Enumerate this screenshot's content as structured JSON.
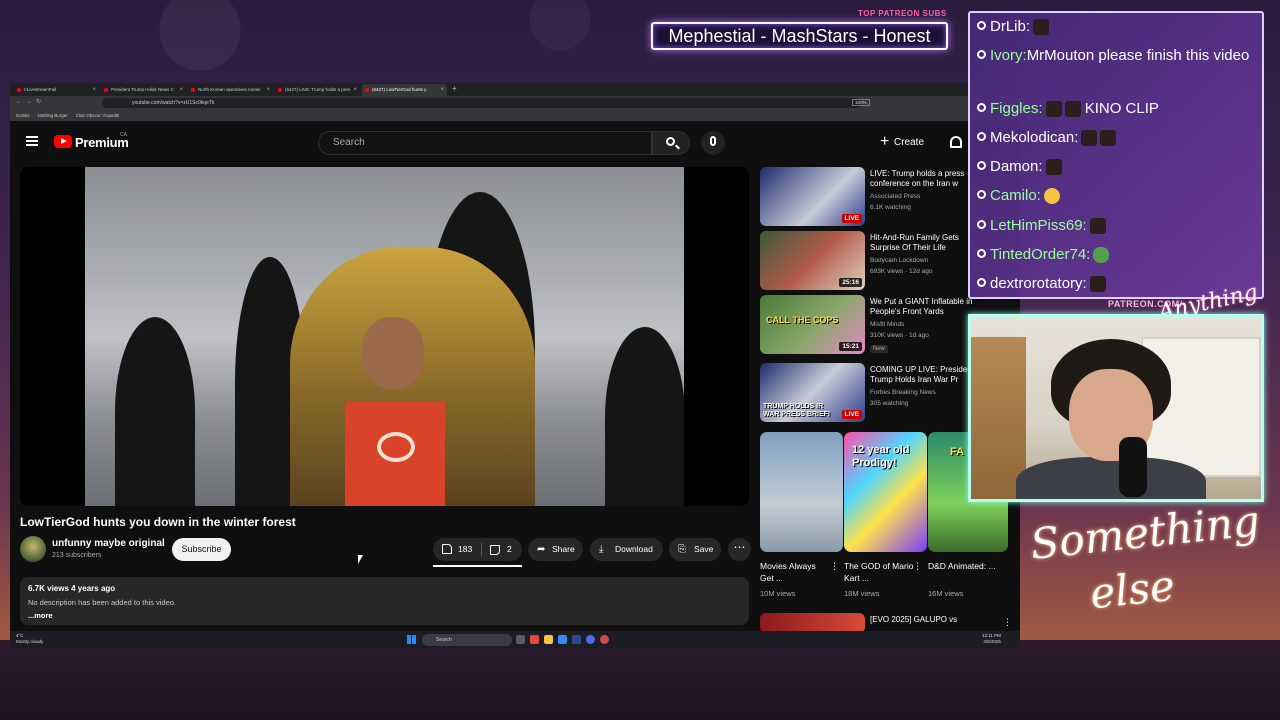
{
  "overlay": {
    "top_patreon_label": "TOP PATREON SUBS",
    "top_patreon_names": "Mephestial - MashStars - Honest",
    "patreon_url": "PATREON.COM/",
    "signature_small": "Anything Else",
    "signature_big_line1": "Something",
    "signature_big_line2": "else"
  },
  "browser": {
    "tabs": [
      {
        "label": "r/LivestreamFail"
      },
      {
        "label": "President Trump Holds News C"
      },
      {
        "label": "North Korean operatives runnin"
      },
      {
        "label": "(6427) LIVE: Trump holds a pres"
      },
      {
        "label": "(6427) LowTierGod hunts y"
      }
    ],
    "url": "youtube.com/watch?v=zU1Sc0kqeTk",
    "zoom": "160%",
    "bookmarks": [
      "Dailies",
      "Nothing Burger",
      "Clair Obscur: Expediti"
    ]
  },
  "youtube": {
    "brand": "Premium",
    "country": "CA",
    "search_placeholder": "Search",
    "create_label": "Create",
    "video": {
      "title": "LowTierGod hunts you down in the winter forest",
      "channel": "unfunny maybe original",
      "subscribers": "213 subscribers",
      "subscribe_label": "Subscribe",
      "likes": "183",
      "dislikes": "2",
      "share_label": "Share",
      "download_label": "Download",
      "save_label": "Save",
      "views_and_age": "6.7K views  4 years ago",
      "description": "No description has been added to this video.",
      "more_label": "...more"
    },
    "recommendations": [
      {
        "title": "LIVE: Trump holds a press conference on the Iran w",
        "channel": "Associated Press",
        "meta": "6.1K watching",
        "badge": "LIVE",
        "thumb_text": ""
      },
      {
        "title": "Hit-And-Run Family Gets Surprise Of Their Life",
        "channel": "Bodycam Lockdown",
        "meta": "693K views · 12d ago",
        "badge": "25:16",
        "thumb_text": ""
      },
      {
        "title": "We Put a GIANT Inflatable in People's Front Yards",
        "channel": "Misfit Minds",
        "meta": "310K views · 1d ago",
        "badge": "15:21",
        "thumb_text": "CALL THE COPS",
        "new": "New"
      },
      {
        "title": "COMING UP LIVE: President Trump Holds Iran War Pr",
        "channel": "Forbes Breaking News",
        "meta": "305 watching",
        "badge": "LIVE",
        "thumb_text": "TRUMP HOLDS IR WAR PRESS BRIEFI"
      }
    ],
    "shorts": [
      {
        "title": "Movies Always Get ...",
        "views": "10M views",
        "thumb_text": ""
      },
      {
        "title": "The GOD of Mario Kart ...",
        "views": "18M views",
        "thumb_text": "12 year old Prodigy!"
      },
      {
        "title": "D&D Animated: ...",
        "views": "16M views",
        "thumb_text": "FA"
      }
    ],
    "bottom_rec_title": "[EVO 2025] GALUPO vs"
  },
  "taskbar": {
    "weather_temp": "4°C",
    "weather_desc": "Mostly cloudy",
    "search_label": "Search",
    "time": "12:11 PM",
    "date": "4/6/2026"
  },
  "chat": [
    {
      "user": "DrLib:",
      "text": "",
      "emote": "dark",
      "color": "#ffffff"
    },
    {
      "user": "Ivory:",
      "text": "MrMouton please finish this video",
      "emote": "",
      "color": "#9bff9b"
    },
    {
      "user": "Figgles:",
      "text": "KINO CLIP",
      "emote": "dark",
      "color": "#9bff9b"
    },
    {
      "user": "Mekolodican:",
      "text": "",
      "emote": "dark",
      "color": "#ffffff"
    },
    {
      "user": "Damon:",
      "text": "",
      "emote": "dark",
      "color": "#ffffff"
    },
    {
      "user": "Camilo:",
      "text": "",
      "emote": "yellow",
      "color": "#9bff9b"
    },
    {
      "user": "LetHimPiss69:",
      "text": "",
      "emote": "dark",
      "color": "#9bff9b"
    },
    {
      "user": "TintedOrder74:",
      "text": "",
      "emote": "frog",
      "color": "#9bff9b"
    },
    {
      "user": "dextrorotatory:",
      "text": "",
      "emote": "dark",
      "color": "#ffffff"
    }
  ]
}
